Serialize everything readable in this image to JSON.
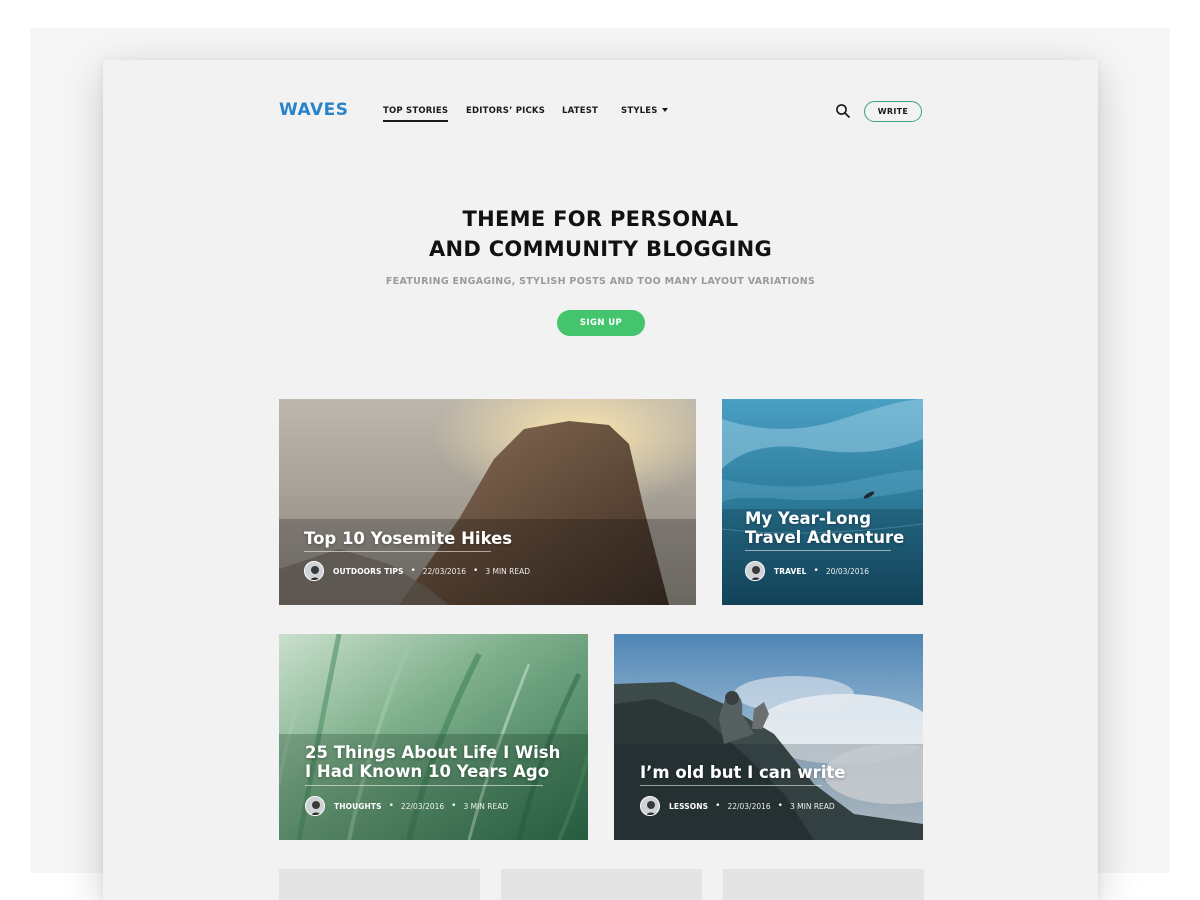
{
  "header": {
    "logo": "WAVES",
    "nav": [
      {
        "label": "TOP STORIES"
      },
      {
        "label": "EDITORS’ PICKS"
      },
      {
        "label": "LATEST"
      },
      {
        "label": "STYLES"
      }
    ],
    "write_label": "WRITE"
  },
  "hero": {
    "title_line1": "THEME FOR PERSONAL",
    "title_line2": "AND COMMUNITY BLOGGING",
    "subtitle": "FEATURING ENGAGING, STYLISH POSTS AND TOO MANY LAYOUT VARIATIONS",
    "cta": "SIGN UP"
  },
  "posts": [
    {
      "title": "Top 10 Yosemite Hikes",
      "category": "OUTDOORS TIPS",
      "date": "22/03/2016",
      "read": "3 MIN READ"
    },
    {
      "title": "My Year-Long Travel Adventure",
      "category": "TRAVEL",
      "date": "20/03/2016",
      "read": ""
    },
    {
      "title": "25 Things About Life I Wish I Had Known 10 Years Ago",
      "category": "THOUGHTS",
      "date": "22/03/2016",
      "read": "3 MIN READ"
    },
    {
      "title": "I’m old but I can write",
      "category": "LESSONS",
      "date": "22/03/2016",
      "read": "3 MIN READ"
    }
  ],
  "colors": {
    "brand": "#2a83c9",
    "accent": "#43c46d",
    "write_border": "#3aa47e"
  }
}
